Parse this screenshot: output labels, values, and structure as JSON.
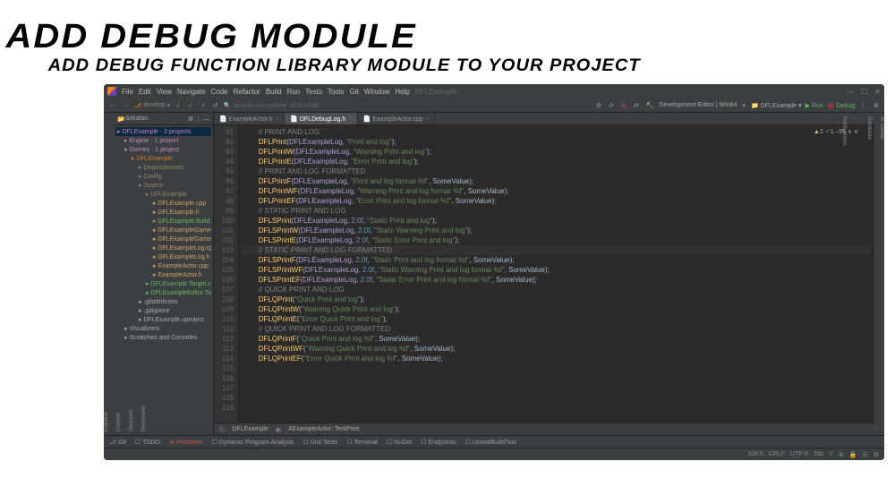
{
  "heading": {
    "title": "ADD DEBUG MODULE",
    "subtitle": "ADD DEBUG FUNCTION LIBRARY MODULE TO YOUR PROJECT"
  },
  "menubar": [
    "File",
    "Edit",
    "View",
    "Navigate",
    "Code",
    "Refactor",
    "Build",
    "Run",
    "Tests",
    "Tools",
    "Git",
    "Window",
    "Help"
  ],
  "project_label": "DFLExample",
  "toolbar": {
    "branch": "develop",
    "search": "Search everywhere",
    "shortcut": "Shift+Shift",
    "config": "Development Editor | Win64",
    "target": "DFLExample",
    "run": "Run",
    "debug": "Debug"
  },
  "sidebar": {
    "header": "Solution",
    "items": [
      {
        "l": 1,
        "t": "DFLExample · 2 projects",
        "c": "tn-proj",
        "sel": 1
      },
      {
        "l": 2,
        "t": "Engine · 1 project",
        "c": "tn-proj"
      },
      {
        "l": 2,
        "t": "Games · 1 project",
        "c": "tn-proj"
      },
      {
        "l": 3,
        "t": "DFLExample",
        "c": "tn-orange"
      },
      {
        "l": 4,
        "t": "Dependencies",
        "c": "tn-folder"
      },
      {
        "l": 4,
        "t": "Config",
        "c": "tn-folder"
      },
      {
        "l": 4,
        "t": "Source",
        "c": "tn-folder"
      },
      {
        "l": 5,
        "t": "DFLExample",
        "c": "tn-folder"
      },
      {
        "l": 6,
        "t": "DFLExample.cpp",
        "c": "tn-cpp"
      },
      {
        "l": 6,
        "t": "DFLExample.h",
        "c": "tn-cpp"
      },
      {
        "l": 6,
        "t": "DFLExample.Build.cs",
        "c": "tn-cs"
      },
      {
        "l": 6,
        "t": "DFLExampleGameM",
        "c": "tn-cpp"
      },
      {
        "l": 6,
        "t": "DFLExampleGameM",
        "c": "tn-cpp"
      },
      {
        "l": 6,
        "t": "DFLExampleLog.cp",
        "c": "tn-cpp"
      },
      {
        "l": 6,
        "t": "DFLExampleLog.h",
        "c": "tn-cpp"
      },
      {
        "l": 6,
        "t": "ExampleActor.cpp",
        "c": "tn-cpp"
      },
      {
        "l": 6,
        "t": "ExampleActor.h",
        "c": "tn-cpp"
      },
      {
        "l": 5,
        "t": "DFLExample.Target.cs",
        "c": "tn-cs"
      },
      {
        "l": 5,
        "t": "DFLExampleEditor.Tar",
        "c": "tn-cs"
      },
      {
        "l": 4,
        "t": ".gitattributes",
        "c": ""
      },
      {
        "l": 4,
        "t": ".gitignore",
        "c": ""
      },
      {
        "l": 4,
        "t": "DFLExample.uproject",
        "c": ""
      },
      {
        "l": 2,
        "t": "Visualizers",
        "c": ""
      },
      {
        "l": 2,
        "t": "Scratches and Consoles",
        "c": ""
      }
    ]
  },
  "left_tabs": [
    "Explorer",
    "Commit",
    "Structure",
    "Bookmarks"
  ],
  "right_tabs": [
    "AI Viewer",
    "Database",
    "..",
    "Notifications"
  ],
  "tabs": [
    {
      "label": "ExampleActor.h",
      "active": 0
    },
    {
      "label": "DFLDebugLog.h",
      "active": 1
    },
    {
      "label": "ExampleActor.cpp",
      "active": 0
    }
  ],
  "warnings": {
    "a": "2",
    "b": "1",
    "c": "95"
  },
  "code": {
    "lines": [
      {
        "n": 91,
        "t": [
          [
            "c",
            "        // PRINT AND LOG"
          ]
        ]
      },
      {
        "n": 92,
        "t": [
          [
            "p",
            "        "
          ],
          [
            "f",
            "DFLPrint"
          ],
          [
            "p",
            "("
          ],
          [
            "v",
            "DFLExampleLog"
          ],
          [
            "p",
            ", "
          ],
          [
            "s",
            "\"Print and log\""
          ],
          [
            "p",
            ");"
          ]
        ]
      },
      {
        "n": 93,
        "t": [
          [
            "p",
            "        "
          ],
          [
            "f",
            "DFLPrintW"
          ],
          [
            "p",
            "("
          ],
          [
            "v",
            "DFLExampleLog"
          ],
          [
            "p",
            ", "
          ],
          [
            "s",
            "\"Warning Print and log\""
          ],
          [
            "p",
            ");"
          ]
        ]
      },
      {
        "n": 94,
        "t": [
          [
            "p",
            "        "
          ],
          [
            "f",
            "DFLPrintE"
          ],
          [
            "p",
            "("
          ],
          [
            "v",
            "DFLExampleLog"
          ],
          [
            "p",
            ", "
          ],
          [
            "s",
            "\"Error Print and log\""
          ],
          [
            "p",
            ");"
          ]
        ]
      },
      {
        "n": 95,
        "t": [
          [
            "p",
            ""
          ]
        ]
      },
      {
        "n": 96,
        "t": [
          [
            "c",
            "        // PRINT AND LOG FORMATTED"
          ]
        ]
      },
      {
        "n": 97,
        "t": [
          [
            "p",
            "        "
          ],
          [
            "f",
            "DFLPrintF"
          ],
          [
            "p",
            "("
          ],
          [
            "v",
            "DFLExampleLog"
          ],
          [
            "p",
            ", "
          ],
          [
            "s",
            "\"Print and log format %f\""
          ],
          [
            "p",
            ", SomeValue);"
          ]
        ]
      },
      {
        "n": 98,
        "t": [
          [
            "p",
            "        "
          ],
          [
            "f",
            "DFLPrintWF"
          ],
          [
            "p",
            "("
          ],
          [
            "v",
            "DFLExampleLog"
          ],
          [
            "p",
            ", "
          ],
          [
            "s",
            "\"Warning Print and log format %f\""
          ],
          [
            "p",
            ", SomeValue);"
          ]
        ]
      },
      {
        "n": 99,
        "t": [
          [
            "p",
            "        "
          ],
          [
            "f",
            "DFLPrintEF"
          ],
          [
            "p",
            "("
          ],
          [
            "v",
            "DFLExampleLog"
          ],
          [
            "p",
            ", "
          ],
          [
            "s",
            "\"Error Print and log format %f\""
          ],
          [
            "p",
            ", SomeValue);"
          ]
        ]
      },
      {
        "n": 100,
        "t": [
          [
            "p",
            ""
          ]
        ]
      },
      {
        "n": 101,
        "t": [
          [
            "c",
            "        // STATIC PRINT AND LOG"
          ]
        ]
      },
      {
        "n": 102,
        "t": [
          [
            "p",
            "        "
          ],
          [
            "f",
            "DFLSPrint"
          ],
          [
            "p",
            "("
          ],
          [
            "v",
            "DFLExampleLog"
          ],
          [
            "p",
            ", "
          ],
          [
            "n",
            "2.0f"
          ],
          [
            "p",
            ", "
          ],
          [
            "s",
            "\"Static Print and log\""
          ],
          [
            "p",
            ");"
          ]
        ]
      },
      {
        "n": 103,
        "t": [
          [
            "p",
            "        "
          ],
          [
            "f",
            "DFLSPrintW"
          ],
          [
            "p",
            "("
          ],
          [
            "v",
            "DFLExampleLog"
          ],
          [
            "p",
            ", "
          ],
          [
            "n",
            "2.0f"
          ],
          [
            "p",
            ", "
          ],
          [
            "s",
            "\"Static Warning Print and log\""
          ],
          [
            "p",
            ");"
          ]
        ]
      },
      {
        "n": 104,
        "t": [
          [
            "p",
            "        "
          ],
          [
            "f",
            "DFLSPrintE"
          ],
          [
            "p",
            "("
          ],
          [
            "v",
            "DFLExampleLog"
          ],
          [
            "p",
            ", "
          ],
          [
            "n",
            "2.0f"
          ],
          [
            "p",
            ", "
          ],
          [
            "s",
            "\"Static Error Print and log\""
          ],
          [
            "p",
            ");"
          ]
        ]
      },
      {
        "n": 105,
        "t": [
          [
            "p",
            ""
          ]
        ]
      },
      {
        "n": 106,
        "hl": 1,
        "t": [
          [
            "c",
            "        // STATIC PRINT AND LOG FORMATTED"
          ]
        ]
      },
      {
        "n": 107,
        "t": [
          [
            "p",
            "        "
          ],
          [
            "f",
            "DFLSPrintF"
          ],
          [
            "p",
            "("
          ],
          [
            "v",
            "DFLExampleLog"
          ],
          [
            "p",
            ", "
          ],
          [
            "n",
            "2.0f"
          ],
          [
            "p",
            ", "
          ],
          [
            "s",
            "\"Static Print and log format %f\""
          ],
          [
            "p",
            ", SomeValue);"
          ]
        ]
      },
      {
        "n": 108,
        "t": [
          [
            "p",
            "        "
          ],
          [
            "f",
            "DFLSPrintWF"
          ],
          [
            "p",
            "("
          ],
          [
            "v",
            "DFLExampleLog"
          ],
          [
            "p",
            ", "
          ],
          [
            "n",
            "2.0f"
          ],
          [
            "p",
            ", "
          ],
          [
            "s",
            "\"Static Warning Print and log format %f\""
          ],
          [
            "p",
            ", SomeValue);"
          ]
        ]
      },
      {
        "n": 109,
        "t": [
          [
            "p",
            "        "
          ],
          [
            "f",
            "DFLSPrintEF"
          ],
          [
            "p",
            "("
          ],
          [
            "v",
            "DFLExampleLog"
          ],
          [
            "p",
            ", "
          ],
          [
            "n",
            "2.0f"
          ],
          [
            "p",
            ", "
          ],
          [
            "s",
            "\"Static Error Print and log format %f\""
          ],
          [
            "p",
            ", SomeValue);"
          ]
        ]
      },
      {
        "n": 110,
        "t": [
          [
            "p",
            ""
          ]
        ]
      },
      {
        "n": 111,
        "t": [
          [
            "c",
            "        // QUICK PRINT AND LOG"
          ]
        ]
      },
      {
        "n": 112,
        "t": [
          [
            "p",
            "        "
          ],
          [
            "f",
            "DFLQPrint"
          ],
          [
            "p",
            "("
          ],
          [
            "s",
            "\"Quick Print and log\""
          ],
          [
            "p",
            ");"
          ]
        ]
      },
      {
        "n": 113,
        "t": [
          [
            "p",
            "        "
          ],
          [
            "f",
            "DFLQPrintW"
          ],
          [
            "p",
            "("
          ],
          [
            "s",
            "\"Warning Quick Print and log\""
          ],
          [
            "p",
            ");"
          ]
        ]
      },
      {
        "n": 114,
        "t": [
          [
            "p",
            "        "
          ],
          [
            "f",
            "DFLQPrintE"
          ],
          [
            "p",
            "("
          ],
          [
            "s",
            "\"Error Quick Print and log\""
          ],
          [
            "p",
            ");"
          ]
        ]
      },
      {
        "n": 115,
        "t": [
          [
            "p",
            ""
          ]
        ]
      },
      {
        "n": 116,
        "t": [
          [
            "c",
            "        // QUICK PRINT AND LOG FORMATTED"
          ]
        ]
      },
      {
        "n": 117,
        "t": [
          [
            "p",
            "        "
          ],
          [
            "f",
            "DFLQPrintF"
          ],
          [
            "p",
            "("
          ],
          [
            "s",
            "\"Quick Print and log %f\""
          ],
          [
            "p",
            ", SomeValue);"
          ]
        ]
      },
      {
        "n": 118,
        "t": [
          [
            "p",
            "        "
          ],
          [
            "f",
            "DFLQPrintWF"
          ],
          [
            "p",
            "("
          ],
          [
            "s",
            "\"Warning Quick Print and log %f\""
          ],
          [
            "p",
            ", SomeValue);"
          ]
        ]
      },
      {
        "n": 119,
        "t": [
          [
            "p",
            "        "
          ],
          [
            "f",
            "DFLQPrintEF"
          ],
          [
            "p",
            "("
          ],
          [
            "s",
            "\"Error Quick Print and log %f\""
          ],
          [
            "p",
            ", SomeValue);"
          ]
        ]
      }
    ]
  },
  "breadcrumb": [
    "DFLExample",
    "AExampleActor::TestPrint"
  ],
  "bottom": [
    "Git",
    "TODO",
    "Problems",
    "Dynamic Program Analysis",
    "Unit Tests",
    "Terminal",
    "NuGet",
    "Endpoints",
    "UnrealBuildTool"
  ],
  "status": {
    "pos": "106:5",
    "eol": "CRLF",
    "enc": "UTF-8",
    "tab": "Tab"
  }
}
